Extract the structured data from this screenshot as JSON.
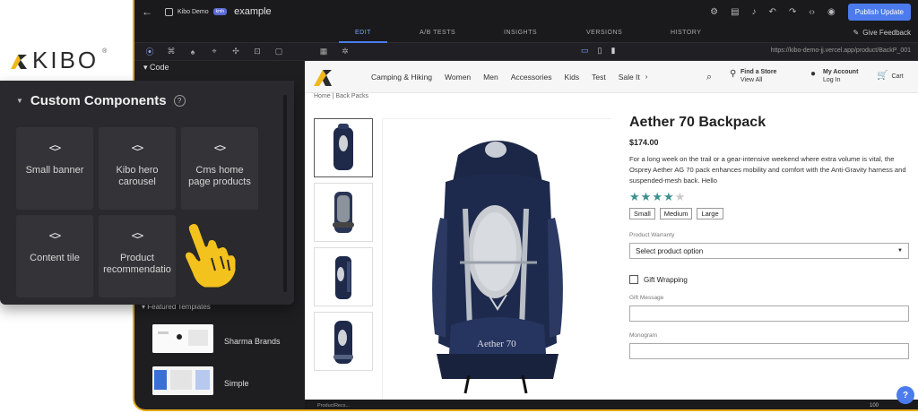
{
  "logo": {
    "text": "KIBO",
    "mark_colors": [
      "#f2b81b",
      "#2b2b2b"
    ]
  },
  "editor": {
    "site_name": "Kibo Demo",
    "env_badge": "kmh",
    "page_name": "example",
    "publish_label": "Publish Update",
    "tabs": [
      "EDIT",
      "A/B TESTS",
      "INSIGHTS",
      "VERSIONS",
      "HISTORY"
    ],
    "active_tab": "EDIT",
    "feedback_label": "Give Feedback",
    "url": "https://kibo-demo-jj.vercel.app/product/BackP_001",
    "code_label": "Code",
    "featured_label": "Featured Templates",
    "templates": [
      "Sharma Brands",
      "Simple"
    ],
    "status_text": "ProductRecs...",
    "zoom": "100",
    "accent": "#4b7bec",
    "highlight": "#e3a917"
  },
  "custom_components": {
    "title": "Custom Components",
    "help_symbol": "?",
    "code_symbol": "<>",
    "items": [
      {
        "label": "Small banner"
      },
      {
        "label": "Kibo hero carousel"
      },
      {
        "label": "Cms home page products"
      },
      {
        "label": "Content tile"
      },
      {
        "label": "Product recommendatio"
      }
    ]
  },
  "store": {
    "nav": [
      "Camping & Hiking",
      "Women",
      "Men",
      "Accessories",
      "Kids",
      "Test",
      "Sale It"
    ],
    "find_store": {
      "title": "Find a Store",
      "sub": "View All"
    },
    "account": {
      "title": "My Account",
      "sub": "Log In"
    },
    "cart_label": "Cart",
    "breadcrumbs": [
      "Home",
      "Back Packs"
    ],
    "product": {
      "title": "Aether 70 Backpack",
      "price": "$174.00",
      "description": "For a long week on the trail or a gear-intensive weekend where extra volume is vital, the Osprey Aether AG 70 pack enhances mobility and comfort with the Anti-Gravity harness and suspended-mesh back. Hello",
      "rating": 4,
      "rating_max": 5,
      "sizes": [
        "Small",
        "Medium",
        "Large"
      ],
      "warranty_label": "Product Warranty",
      "warranty_placeholder": "Select product option",
      "gift_wrap_label": "Gift Wrapping",
      "gift_message_label": "Gift Message",
      "monogram_label": "Monogram",
      "pack_text": "Aether 70"
    }
  }
}
